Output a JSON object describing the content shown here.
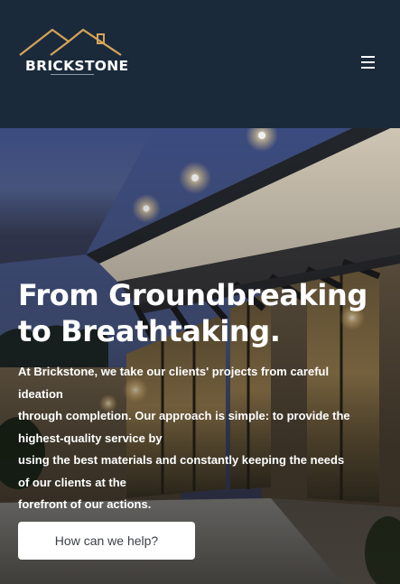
{
  "header": {
    "logo_text": "BRICKSTONE",
    "menu_icon": "hamburger-menu-icon"
  },
  "hero": {
    "title_line1": "From Groundbreaking",
    "title_line2": "to Breathtaking.",
    "body_lines": [
      "At Brickstone, we take our clients' projects from careful",
      "ideation",
      "through completion. Our approach is simple: to provide the",
      "highest-quality service by",
      "using the best materials and constantly keeping the needs",
      "of our clients at the",
      "forefront of our actions."
    ],
    "cta_label": "How can we help?"
  },
  "colors": {
    "header_bg": "#1b2a3b",
    "logo_accent": "#d6a456",
    "text": "#ffffff",
    "cta_bg": "#ffffff",
    "cta_text": "#3b3f45"
  }
}
